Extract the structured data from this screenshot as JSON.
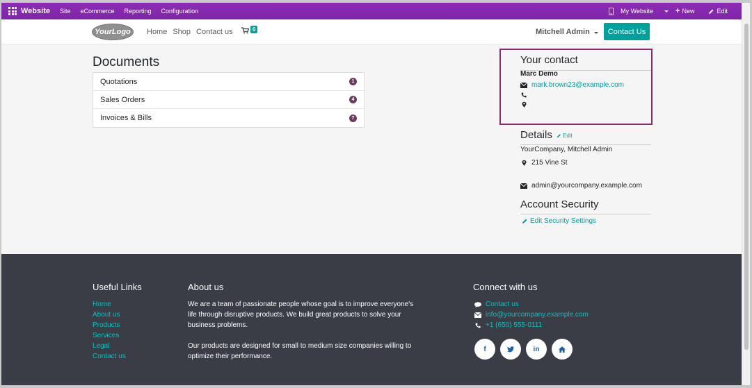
{
  "admin_bar": {
    "brand": "Website",
    "menu": [
      "Site",
      "eCommerce",
      "Reporting",
      "Configuration"
    ],
    "my_website": "My Website",
    "new": "New",
    "edit": "Edit"
  },
  "header": {
    "logo": "YourLogo",
    "nav": [
      "Home",
      "Shop",
      "Contact us"
    ],
    "cart_count": "0",
    "user": "Mitchell Admin",
    "contact_button": "Contact Us"
  },
  "documents": {
    "title": "Documents",
    "items": [
      {
        "label": "Quotations",
        "count": "1"
      },
      {
        "label": "Sales Orders",
        "count": "4"
      },
      {
        "label": "Invoices & Bills",
        "count": "7"
      }
    ]
  },
  "your_contact": {
    "title": "Your contact",
    "name": "Marc Demo",
    "email": "mark.brown23@example.com"
  },
  "details": {
    "title": "Details",
    "edit": "Edit",
    "company": "YourCompany, Mitchell Admin",
    "address": "215 Vine St",
    "email": "admin@yourcompany.example.com"
  },
  "account_security": {
    "title": "Account Security",
    "edit_link": "Edit Security Settings"
  },
  "footer": {
    "useful_links_title": "Useful Links",
    "useful_links": [
      "Home",
      "About us",
      "Products",
      "Services",
      "Legal",
      "Contact us"
    ],
    "about_title": "About us",
    "about_p1": "We are a team of passionate people whose goal is to improve everyone's life through disruptive products. We build great products to solve your business problems.",
    "about_p2": "Our products are designed for small to medium size companies willing to optimize their performance.",
    "connect_title": "Connect with us",
    "connect": {
      "contact": "Contact us",
      "email": "info@yourcompany.example.com",
      "phone": "+1 (650) 555-0111"
    },
    "socials": [
      "f",
      "t",
      "in",
      "home"
    ]
  }
}
